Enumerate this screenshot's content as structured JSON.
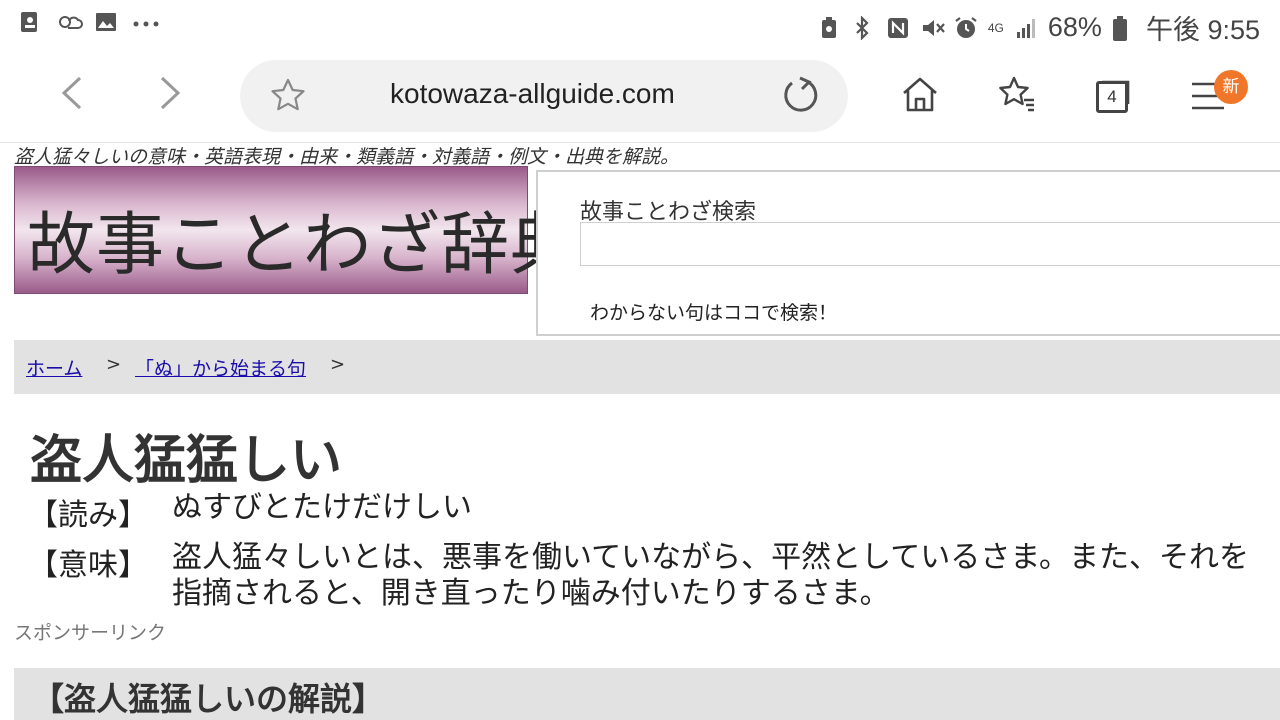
{
  "status_bar": {
    "battery_percent": "68%",
    "network": "4G",
    "time": "午後 9:55",
    "left_icons": [
      "contacts-icon",
      "weather-icon",
      "gallery-icon",
      "more-dots-icon"
    ],
    "right_icons": [
      "recycle-icon",
      "bluetooth-icon",
      "nfc-icon",
      "mute-icon",
      "alarm-icon",
      "signal-icon",
      "battery-icon"
    ]
  },
  "browser": {
    "url": "kotowaza-allguide.com",
    "tab_count": "4",
    "menu_badge": "新"
  },
  "page": {
    "tagline": "盗人猛々しいの意味・英語表現・由来・類義語・対義語・例文・出典を解説。",
    "logo_text": "故事ことわざ辞典",
    "search": {
      "label": "故事ことわざ検索",
      "value": "",
      "hint": "わからない句はココで検索！"
    },
    "breadcrumb": {
      "home": "ホーム",
      "category": "「ぬ」から始まる句",
      "separator": ">"
    },
    "title": "盗人猛猛しい",
    "reading_label": "【読み】",
    "reading": "ぬすびとたけだけしい",
    "meaning_label": "【意味】",
    "meaning": "盗人猛々しいとは、悪事を働いていながら、平然としているさま。また、それを指摘されると、開き直ったり噛み付いたりするさま。",
    "sponsor": "スポンサーリンク",
    "section_title": "【盗人猛猛しいの解説】"
  },
  "colors": {
    "link": "#1a0dab",
    "badge": "#f0772a",
    "logo_gradient_dark": "#9a5b8a",
    "band": "#e2e2e2"
  }
}
